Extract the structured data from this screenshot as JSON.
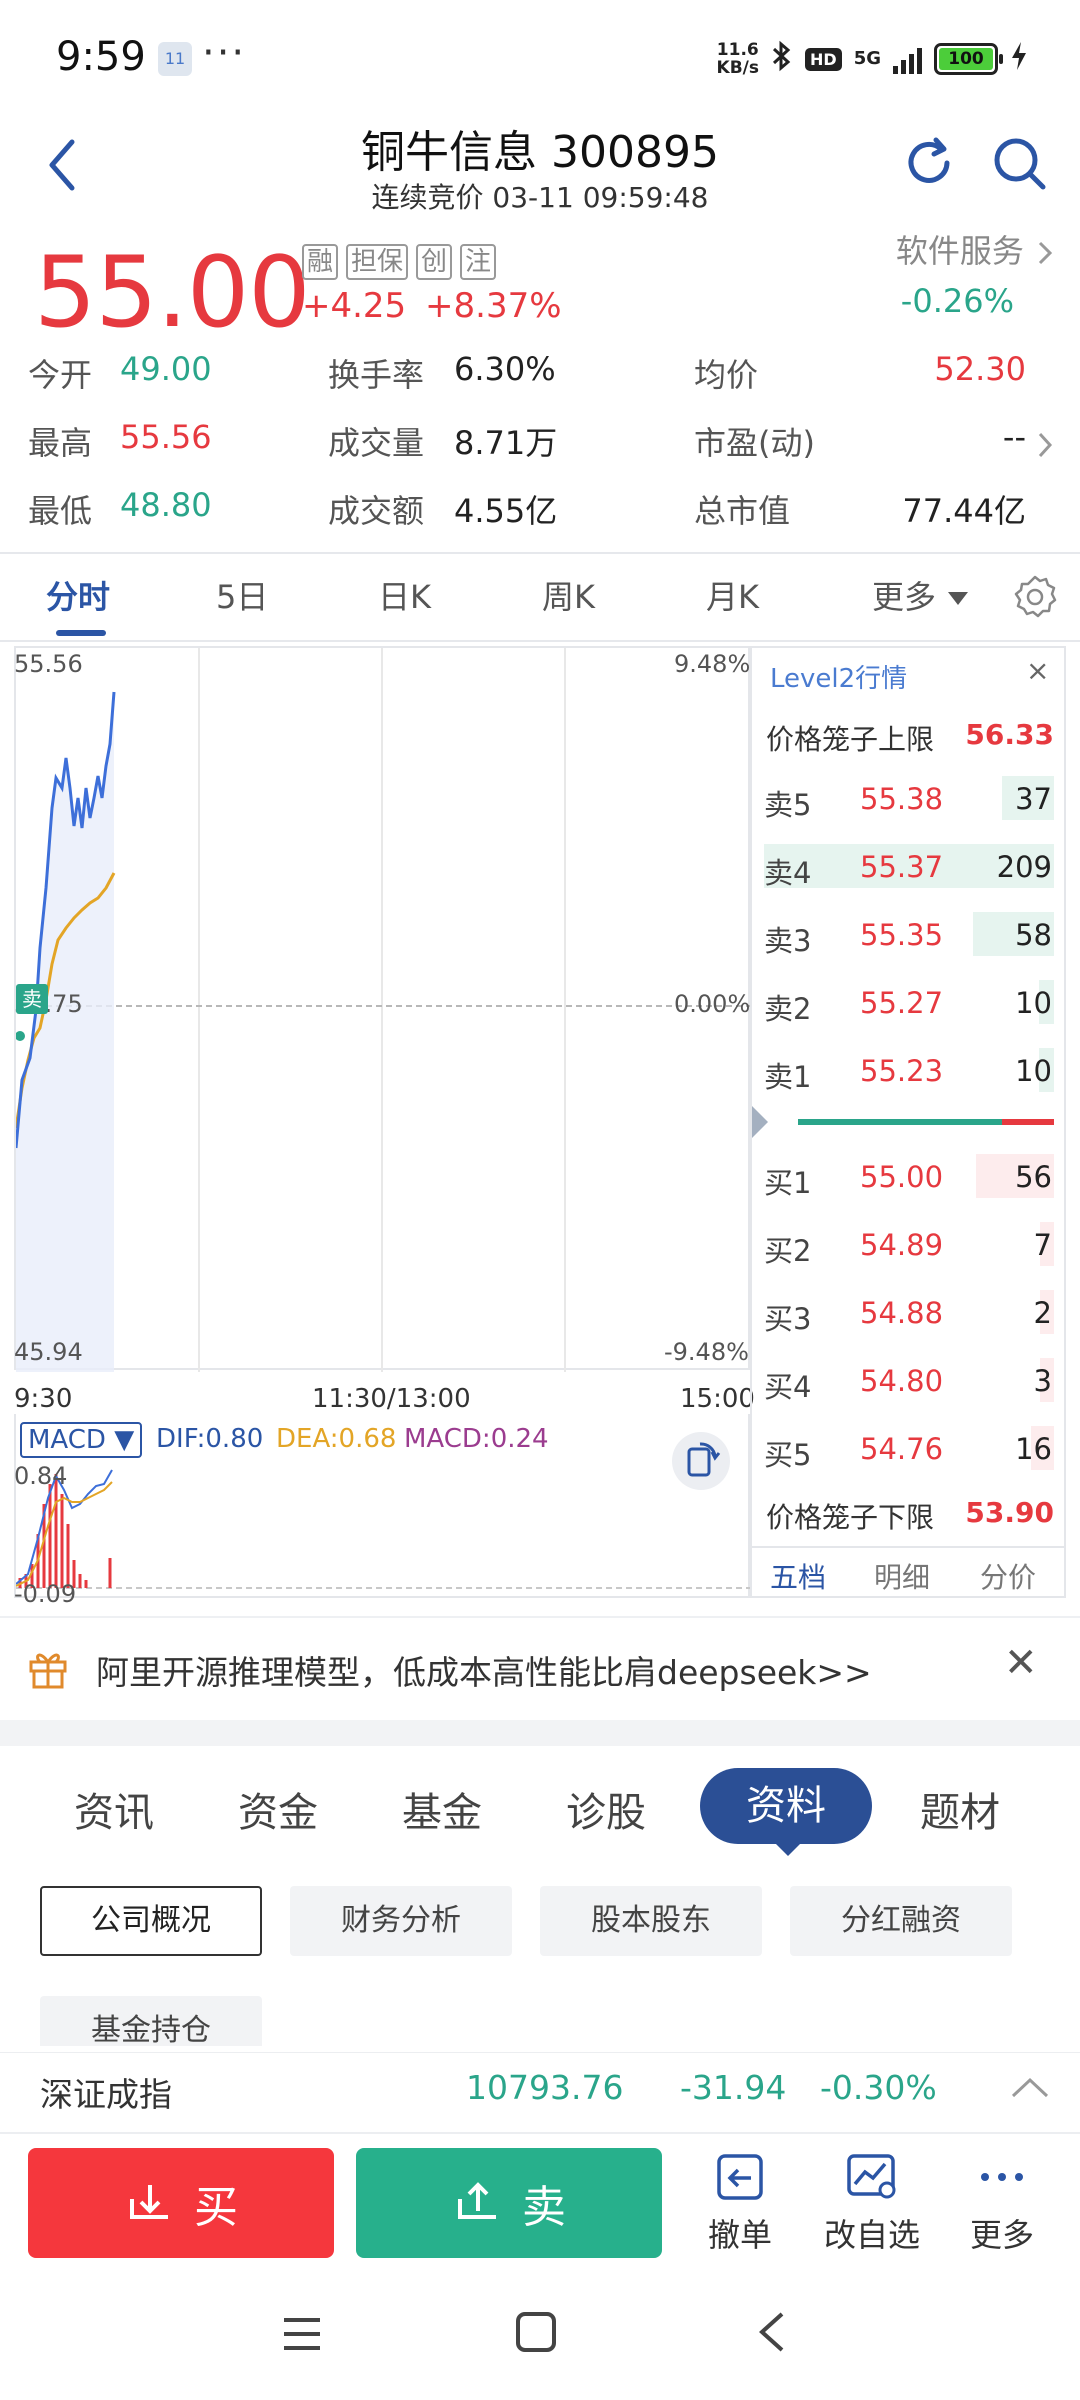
{
  "status_bar": {
    "time": "9:59",
    "notification_badge": "11",
    "more": "···",
    "net_speed_value": "11.6",
    "net_speed_unit": "KB/s",
    "hd": "HD",
    "network": "5G",
    "battery": "100"
  },
  "header": {
    "title": "铜牛信息 300895",
    "subtitle": "连续竞价 03-11 09:59:48"
  },
  "quote": {
    "price": "55.00",
    "tags": [
      "融",
      "担保",
      "创",
      "注"
    ],
    "change": "+4.25",
    "change_pct": "+8.37%",
    "sector": "软件服务",
    "sector_change": "-0.26%"
  },
  "stats": {
    "open_label": "今开",
    "open": "49.00",
    "turnover_rate_label": "换手率",
    "turnover_rate": "6.30%",
    "avg_label": "均价",
    "avg": "52.30",
    "high_label": "最高",
    "high": "55.56",
    "volume_label": "成交量",
    "volume": "8.71万",
    "pe_label": "市盈(动)",
    "pe": "--",
    "low_label": "最低",
    "low": "48.80",
    "amount_label": "成交额",
    "amount": "4.55亿",
    "mktcap_label": "总市值",
    "mktcap": "77.44亿"
  },
  "chart_tabs": [
    "分时",
    "5日",
    "日K",
    "周K",
    "月K",
    "更多"
  ],
  "chart": {
    "y_top": "55.56",
    "y_mid": "50.75",
    "y_bottom": "45.94",
    "pct_top": "9.48%",
    "pct_mid": "0.00%",
    "pct_bottom": "-9.48%",
    "sell_marker": "卖",
    "time_start": "9:30",
    "time_mid": "11:30/13:00",
    "time_end": "15:00"
  },
  "macd": {
    "select": "MACD ▼",
    "dif": "DIF:0.80",
    "dea": "DEA:0.68",
    "macd": "MACD:0.24",
    "y_top": "0.84",
    "y_bottom": "-0.09"
  },
  "order_book": {
    "title": "Level2行情",
    "close": "×",
    "upper_limit_label": "价格笼子上限",
    "upper_limit": "56.33",
    "asks": [
      {
        "label": "卖5",
        "price": "55.38",
        "volume": "37",
        "ratio": 0.18
      },
      {
        "label": "卖4",
        "price": "55.37",
        "volume": "209",
        "ratio": 1.0
      },
      {
        "label": "卖3",
        "price": "55.35",
        "volume": "58",
        "ratio": 0.28
      },
      {
        "label": "卖2",
        "price": "55.27",
        "volume": "10",
        "ratio": 0.05
      },
      {
        "label": "卖1",
        "price": "55.23",
        "volume": "10",
        "ratio": 0.05
      }
    ],
    "bids": [
      {
        "label": "买1",
        "price": "55.00",
        "volume": "56",
        "ratio": 0.27
      },
      {
        "label": "买2",
        "price": "54.89",
        "volume": "7",
        "ratio": 0.04
      },
      {
        "label": "买3",
        "price": "54.88",
        "volume": "2",
        "ratio": 0.02
      },
      {
        "label": "买4",
        "price": "54.80",
        "volume": "3",
        "ratio": 0.02
      },
      {
        "label": "买5",
        "price": "54.76",
        "volume": "16",
        "ratio": 0.08
      }
    ],
    "lower_limit_label": "价格笼子下限",
    "lower_limit": "53.90",
    "tabs": [
      "五档",
      "明细",
      "分价"
    ]
  },
  "ad": {
    "text": "阿里开源推理模型，低成本高性能比肩deepseek>>"
  },
  "info_tabs": [
    "资讯",
    "资金",
    "基金",
    "诊股",
    "资料",
    "题材"
  ],
  "sub_tabs": [
    "公司概况",
    "财务分析",
    "股本股东",
    "分红融资",
    "基金持仓"
  ],
  "ticker": {
    "name": "深证成指",
    "value": "10793.76",
    "change": "-31.94",
    "change_pct": "-0.30%"
  },
  "bottom_bar": {
    "buy": "买",
    "sell": "卖",
    "cancel": "撤单",
    "watchlist": "改自选",
    "more": "更多"
  },
  "colors": {
    "up": "#e6393f",
    "down": "#2aa58a",
    "accent": "#2b55a5"
  }
}
